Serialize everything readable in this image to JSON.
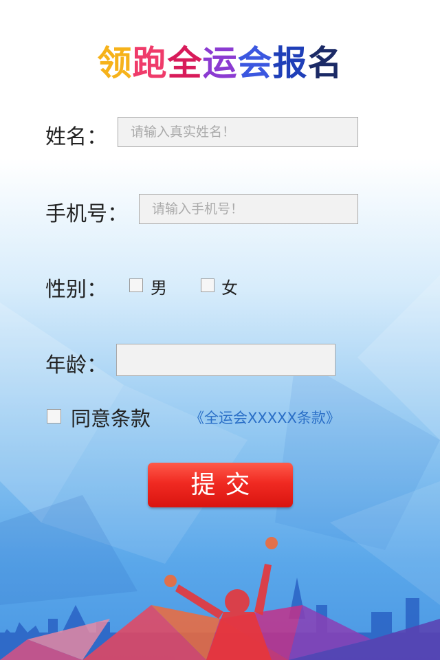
{
  "header": {
    "title_chars": [
      "领",
      "跑",
      "全",
      "运",
      "会",
      "报",
      "名"
    ],
    "title_colors": [
      "#f6b21a",
      "#ef3b6a",
      "#d81b5a",
      "#8b3bd1",
      "#3b57e0",
      "#1f3fb8",
      "#1b2a66"
    ]
  },
  "form": {
    "name_label": "姓名：",
    "name_placeholder": "请输入真实姓名！",
    "phone_label": "手机号：",
    "phone_placeholder": "请输入手机号！",
    "gender_label": "性别：",
    "gender_male": "男",
    "gender_female": "女",
    "age_label": "年龄：",
    "age_value": "",
    "agree_label": "同意条款",
    "terms_link": "《全运会XXXXX条款》",
    "submit_label": "提交"
  },
  "colors": {
    "accent_red": "#e8221c",
    "link_blue": "#2a6fc7"
  }
}
